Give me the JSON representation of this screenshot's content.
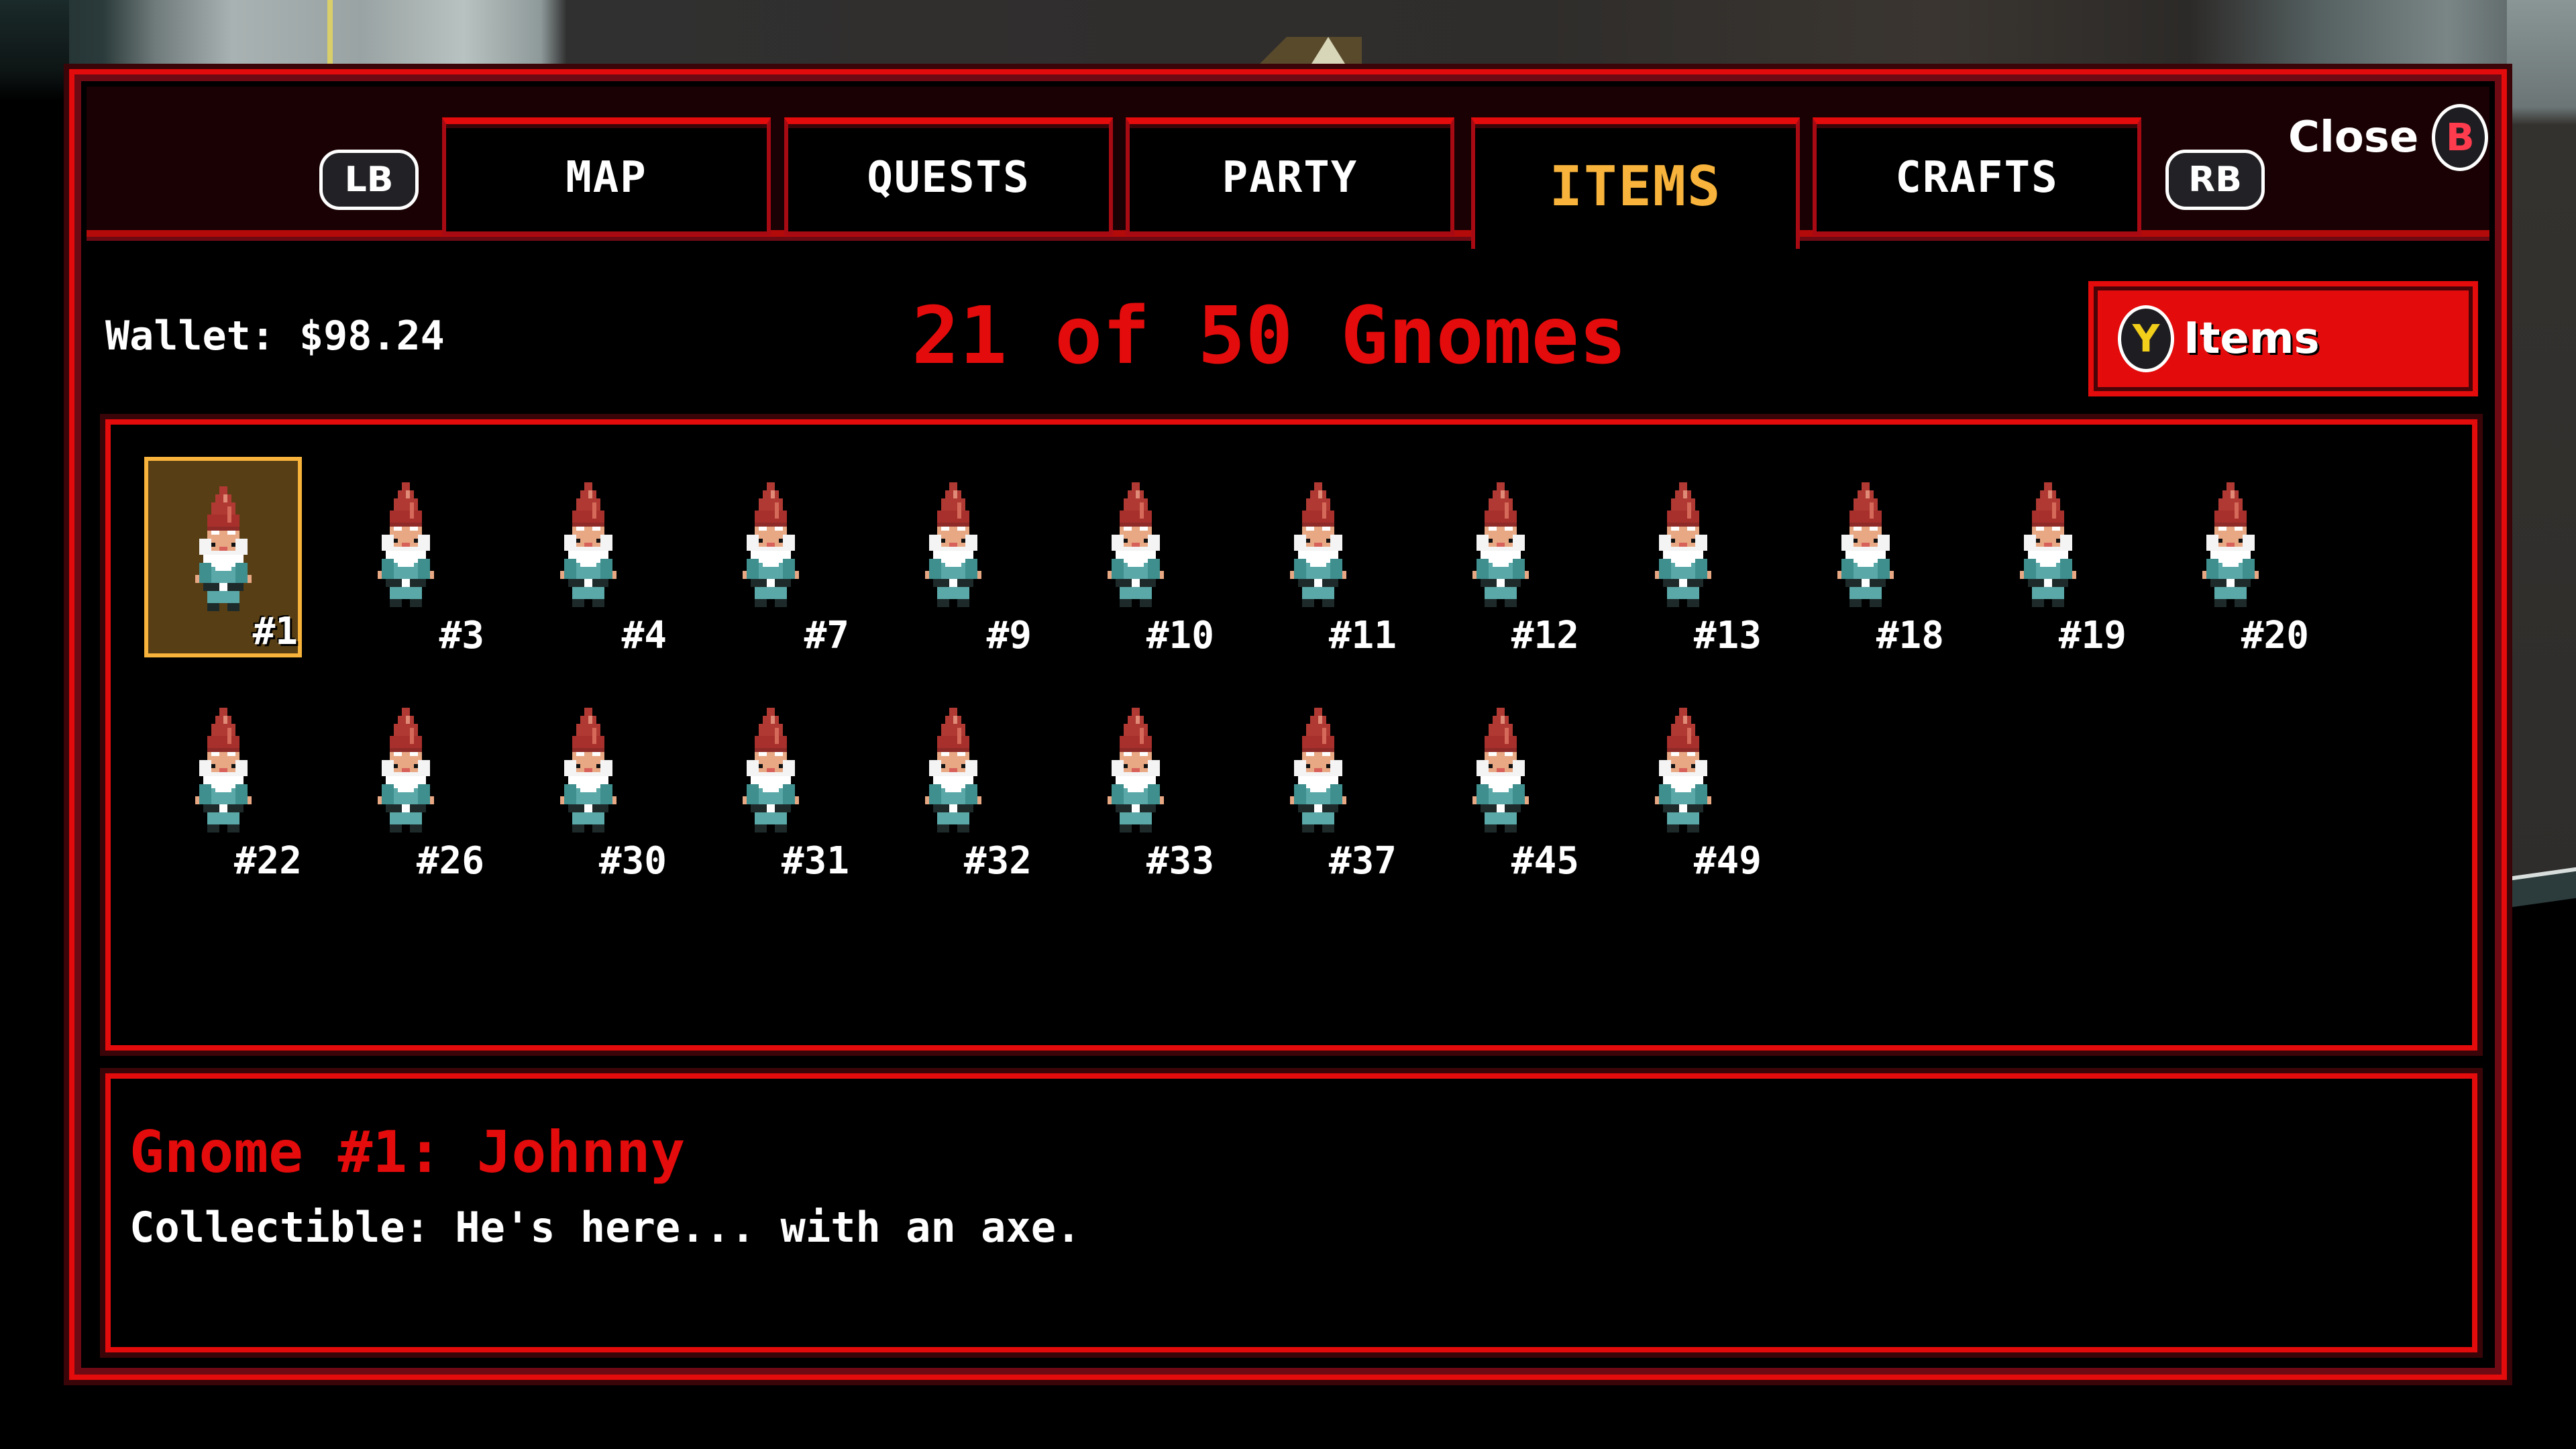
{
  "navigation": {
    "left_shoulder": "LB",
    "right_shoulder": "RB",
    "tabs": [
      {
        "label": "MAP",
        "active": false
      },
      {
        "label": "QUESTS",
        "active": false
      },
      {
        "label": "PARTY",
        "active": false
      },
      {
        "label": "ITEMS",
        "active": true
      },
      {
        "label": "CRAFTS",
        "active": false
      }
    ],
    "close": {
      "label": "Close",
      "button": "B"
    }
  },
  "header": {
    "wallet": "Wallet: $98.24",
    "collection_title": "21 of 50 Gnomes",
    "items_button": {
      "button": "Y",
      "label": "Items"
    }
  },
  "gnomes": [
    {
      "label": "#1",
      "selected": true
    },
    {
      "label": "#3"
    },
    {
      "label": "#4"
    },
    {
      "label": "#7"
    },
    {
      "label": "#9"
    },
    {
      "label": "#10"
    },
    {
      "label": "#11"
    },
    {
      "label": "#12"
    },
    {
      "label": "#13"
    },
    {
      "label": "#18"
    },
    {
      "label": "#19"
    },
    {
      "label": "#20"
    },
    {
      "label": "#22"
    },
    {
      "label": "#26"
    },
    {
      "label": "#30"
    },
    {
      "label": "#31"
    },
    {
      "label": "#32"
    },
    {
      "label": "#33"
    },
    {
      "label": "#37"
    },
    {
      "label": "#45"
    },
    {
      "label": "#49"
    }
  ],
  "description": {
    "title": "Gnome #1: Johnny",
    "text": "Collectible: He's here... with an axe."
  },
  "colors": {
    "accent_red": "#e30b0b",
    "active_tab_text": "#f7b33b",
    "selection_bg": "#573e14",
    "close_button_letter": "#ff3b4e",
    "y_button_letter": "#f2cf1b"
  }
}
